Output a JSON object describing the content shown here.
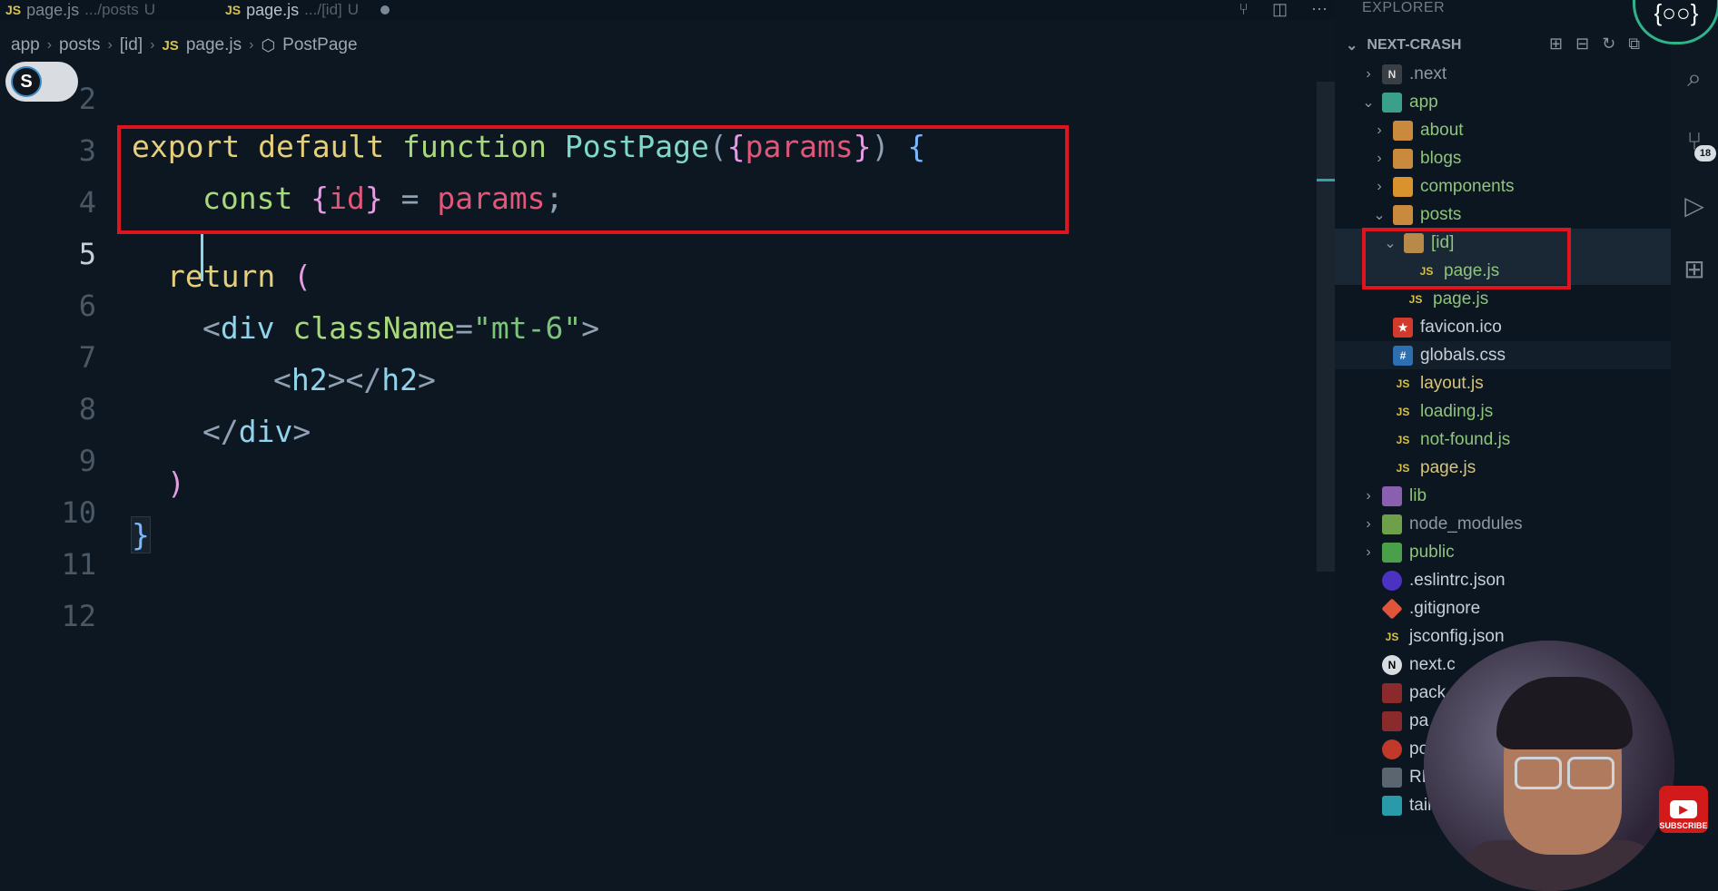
{
  "tabs": [
    {
      "badge": "JS",
      "name": "page.js",
      "path": ".../posts",
      "status": "U"
    },
    {
      "badge": "JS",
      "name": "page.js",
      "path": ".../[id]",
      "status": "U"
    }
  ],
  "breadcrumb": {
    "segments": [
      "app",
      "posts",
      "[id]"
    ],
    "file_badge": "JS",
    "file": "page.js",
    "symbol": "PostPage"
  },
  "toggle": {
    "letter": "S"
  },
  "editor": {
    "line_numbers": [
      "2",
      "3",
      "4",
      "5",
      "6",
      "7",
      "8",
      "9",
      "10",
      "11",
      "12"
    ],
    "code": {
      "l3": {
        "export": "export",
        "default": "default",
        "function": "function",
        "name": "PostPage",
        "open_paren": "(",
        "open_brace": "{",
        "param": "params",
        "close_brace": "}",
        "close_paren": ")",
        "body_brace": "{"
      },
      "l4": {
        "const": "const",
        "open_brace": "{",
        "id": "id",
        "close_brace": "}",
        "eq": "=",
        "value": "params",
        "semi": ";"
      },
      "l6": {
        "kw": "return",
        "paren": "("
      },
      "l7": {
        "open": "<",
        "tag": "div",
        "attr": "className",
        "eq": "=",
        "str": "\"mt-6\"",
        "close": ">"
      },
      "l8": {
        "open": "<",
        "tag": "h2",
        "mid": "></",
        "tag2": "h2",
        "close": ">"
      },
      "l9": {
        "open": "</",
        "tag": "div",
        "close": ">"
      },
      "l10": {
        "paren": ")"
      },
      "l11": {
        "brace": "}"
      }
    }
  },
  "explorer": {
    "header": "EXPLORER",
    "project": "NEXT-CRASH",
    "items": [
      {
        "label": ".next",
        "badge": "N"
      },
      {
        "label": "app",
        "status": ""
      },
      {
        "label": "about"
      },
      {
        "label": "blogs"
      },
      {
        "label": "components"
      },
      {
        "label": "posts"
      },
      {
        "label": "[id]"
      },
      {
        "label": "page.js",
        "badge": "JS",
        "status": "U"
      },
      {
        "label": "page.js",
        "badge": "JS",
        "status": "U"
      },
      {
        "label": "favicon.ico"
      },
      {
        "label": "globals.css"
      },
      {
        "label": "layout.js",
        "badge": "JS",
        "status": "M"
      },
      {
        "label": "loading.js",
        "badge": "JS",
        "status": "U"
      },
      {
        "label": "not-found.js",
        "badge": "JS",
        "status": "U"
      },
      {
        "label": "page.js",
        "badge": "JS",
        "status": "M"
      },
      {
        "label": "lib"
      },
      {
        "label": "node_modules"
      },
      {
        "label": "public"
      },
      {
        "label": ".eslintrc.json"
      },
      {
        "label": ".gitignore"
      },
      {
        "label": "jsconfig.json",
        "badge": "JS"
      },
      {
        "label": "next.c",
        "badge": "N"
      },
      {
        "label": "pack"
      },
      {
        "label": "pa"
      },
      {
        "label": "po"
      },
      {
        "label": "RE"
      },
      {
        "label": "tailv"
      }
    ]
  },
  "activity": {
    "badge_count": "18"
  },
  "logo": {
    "text": "{○○}"
  },
  "youtube": {
    "label": "SUBSCRIBE"
  },
  "colors": {
    "highlight_box": "#e0141e",
    "accent": "#2fa3a8"
  }
}
